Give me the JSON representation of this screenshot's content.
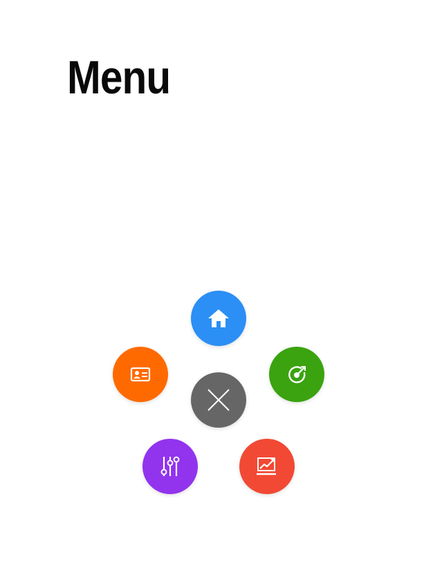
{
  "page": {
    "title": "Menu"
  },
  "radial_menu": {
    "items": [
      {
        "id": "home",
        "icon": "home-icon",
        "color": "#2b8ff5"
      },
      {
        "id": "profile",
        "icon": "id-card-icon",
        "color": "#ff6a00"
      },
      {
        "id": "target",
        "icon": "target-icon",
        "color": "#3aa30f"
      },
      {
        "id": "close",
        "icon": "close-icon",
        "color": "#666666"
      },
      {
        "id": "settings",
        "icon": "sliders-icon",
        "color": "#9233ee"
      },
      {
        "id": "stats",
        "icon": "trend-chart-icon",
        "color": "#f24934"
      }
    ]
  }
}
